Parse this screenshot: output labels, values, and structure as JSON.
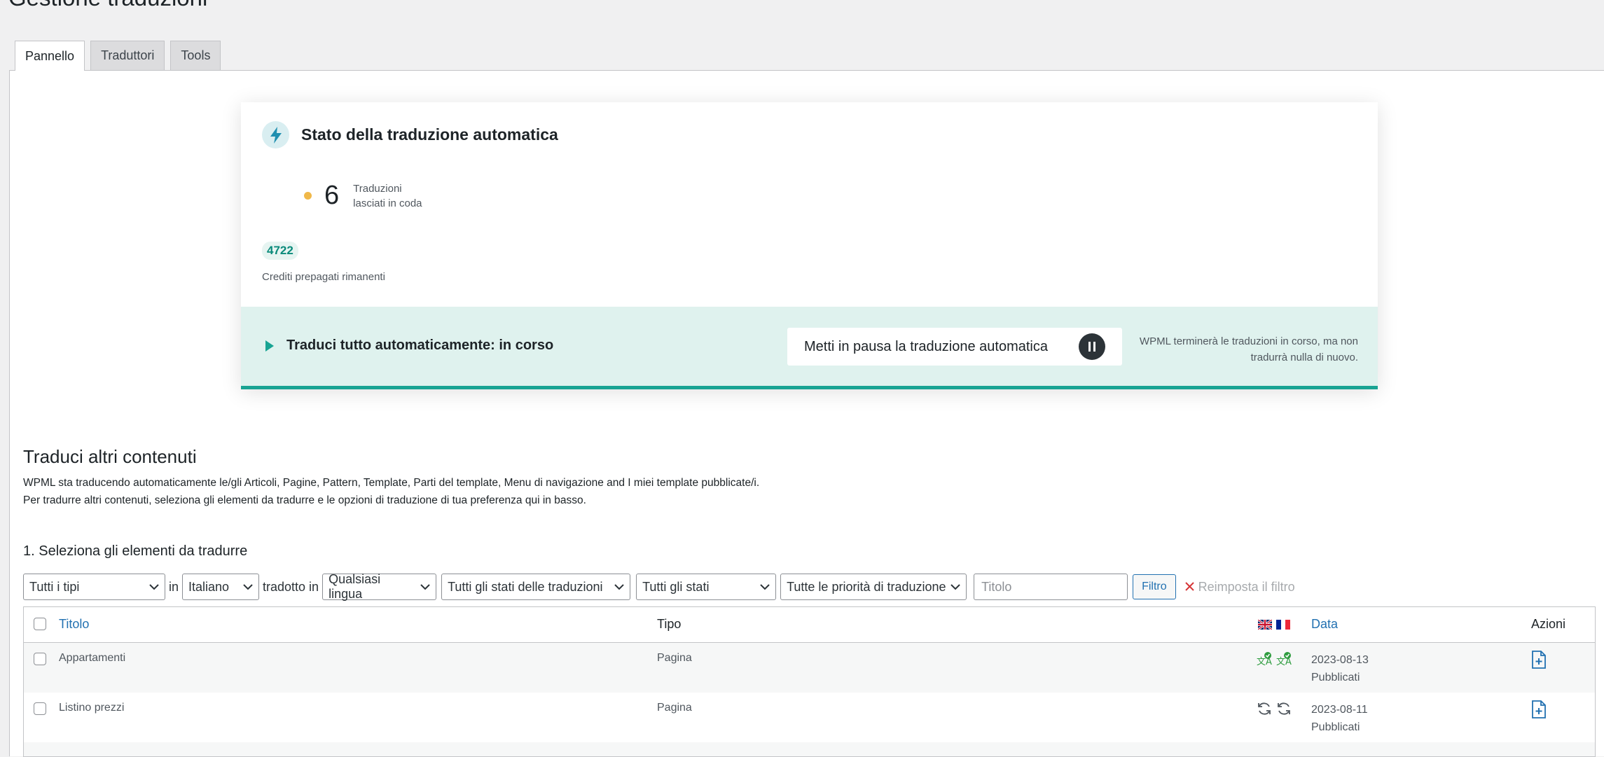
{
  "page": {
    "title": "Gestione traduzioni"
  },
  "tabs": [
    {
      "label": "Pannello",
      "active": true
    },
    {
      "label": "Traduttori",
      "active": false
    },
    {
      "label": "Tools",
      "active": false
    }
  ],
  "status_card": {
    "title": "Stato della traduzione automatica",
    "icon": "bolt-icon",
    "queue_count": "6",
    "queue_label_line1": "Traduzioni",
    "queue_label_line2": "lasciati in coda",
    "credits_value": "4722",
    "credits_label": "Crediti prepagati rimanenti",
    "footer": {
      "status_text": "Traduci tutto automaticamente: in corso",
      "pause_button_label": "Metti in pausa la traduzione automatica",
      "note_line1": "WPML terminerà le traduzioni in corso, ma non",
      "note_line2": "tradurrà nulla di nuovo."
    }
  },
  "content_section": {
    "title": "Traduci altri contenuti",
    "desc_line1": "WPML sta traducendo automaticamente le/gli Articoli, Pagine, Pattern, Template, Parti del template, Menu di navigazione and I miei template pubblicate/i.",
    "desc_line2": "Per tradurre altri contenuti, seleziona gli elementi da tradurre e le opzioni di traduzione di tua preferenza qui in basso.",
    "step_title": "1. Seleziona gli elementi da tradurre"
  },
  "filters": {
    "type_select": "Tutti i tipi",
    "in_label": "in",
    "language_select": "Italiano",
    "translated_in_label": "tradotto in",
    "target_language_select": "Qualsiasi lingua",
    "translation_status_select": "Tutti gli stati delle traduzioni",
    "status_select": "Tutti gli stati",
    "priority_select": "Tutte le priorità di traduzione",
    "title_placeholder": "Titolo",
    "filter_button": "Filtro",
    "reset_label": "Reimposta il filtro"
  },
  "table": {
    "headers": {
      "title": "Titolo",
      "type": "Tipo",
      "date": "Data",
      "actions": "Azioni"
    },
    "language_flags": [
      "uk-flag-icon",
      "fr-flag-icon"
    ],
    "rows": [
      {
        "title": "Appartamenti",
        "type": "Pagina",
        "status_icon": "translated-check-icon",
        "date": "2023-08-13",
        "state": "Pubblicati"
      },
      {
        "title": "Listino prezzi",
        "type": "Pagina",
        "status_icon": "refresh-icon",
        "date": "2023-08-11",
        "state": "Pubblicati"
      }
    ]
  },
  "colors": {
    "accent": "#18a493",
    "link": "#2271b1",
    "card_footer_bg": "#dff2ee",
    "queue_dot": "#f0b849",
    "success": "#2e9c3f"
  }
}
